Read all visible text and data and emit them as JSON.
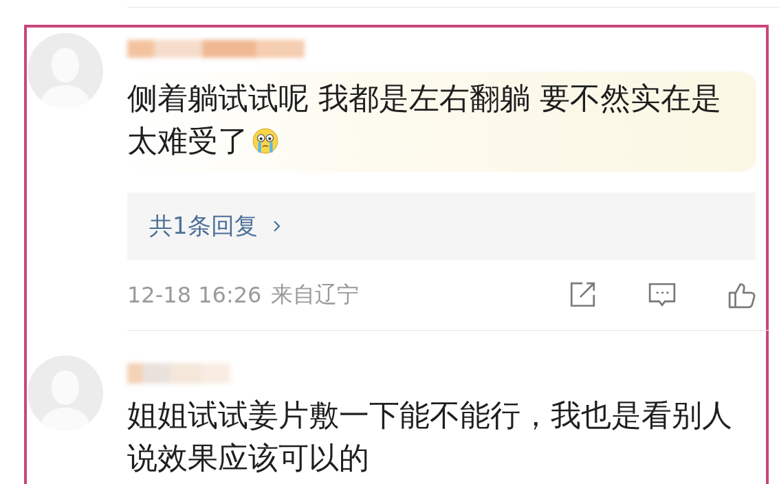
{
  "comments": [
    {
      "highlighted": true,
      "text": "侧着躺试试呢 我都是左右翻躺 要不然实在是太难受了",
      "trailing_emoji": true,
      "replies": "共1条回复",
      "time": "12-18 16:26",
      "location": "来自辽宁"
    },
    {
      "highlighted": false,
      "text": "姐姐试试姜片敷一下能不能行，我也是看别人说效果应该可以的",
      "trailing_emoji": false
    }
  ]
}
